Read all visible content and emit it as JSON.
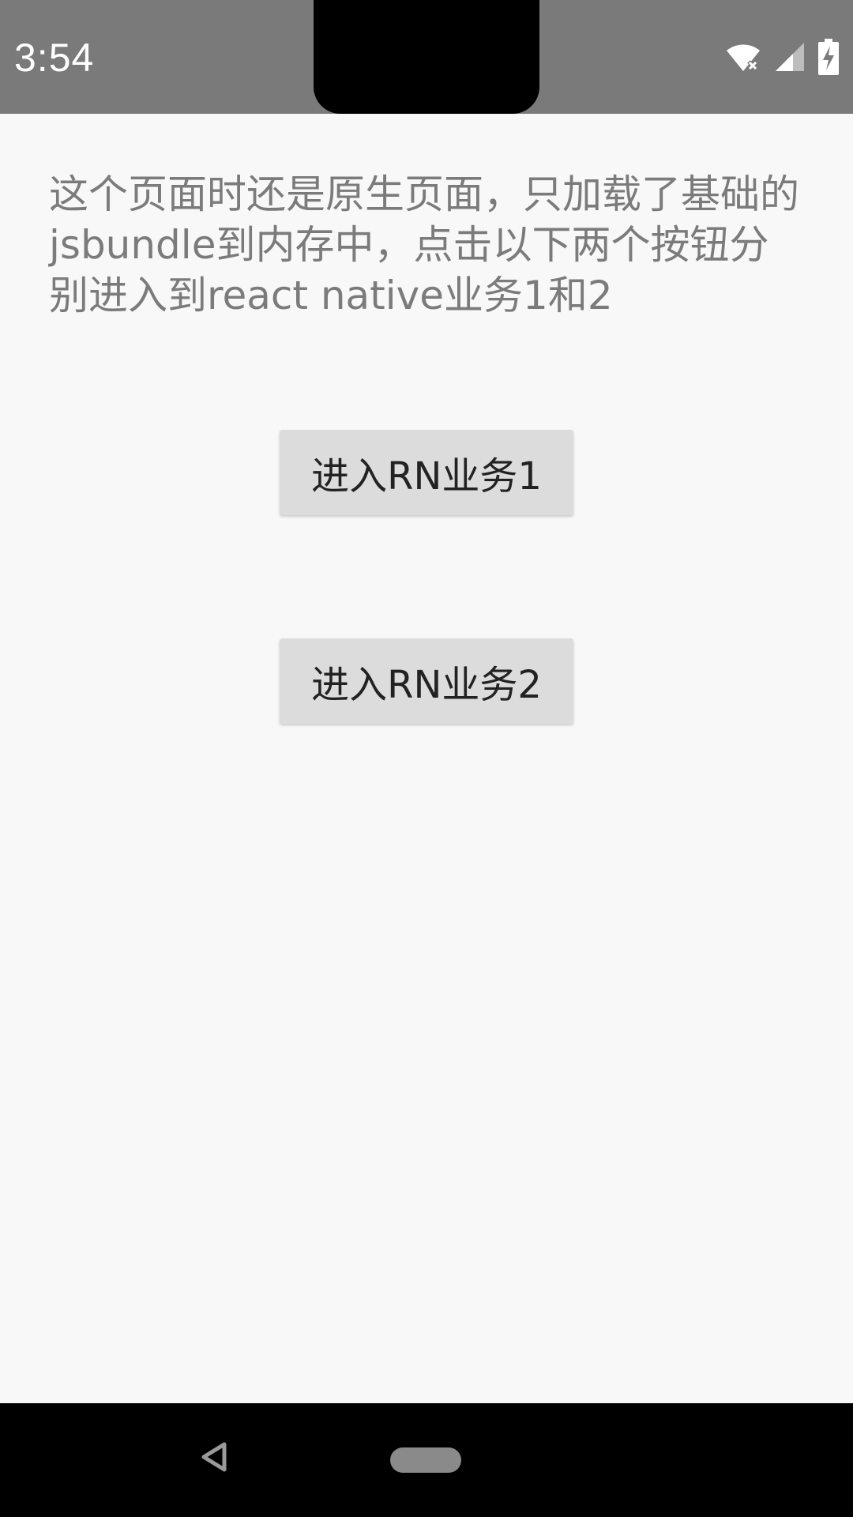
{
  "status_bar": {
    "time": "3:54",
    "icons": [
      "wifi-icon",
      "cell-signal-icon",
      "battery-charging-icon"
    ]
  },
  "main": {
    "intro_text": "这个页面时还是原生页面，只加载了基础的jsbundle到内存中，点击以下两个按钮分别进入到react native业务1和2",
    "buttons": [
      {
        "label": "进入RN业务1"
      },
      {
        "label": "进入RN业务2"
      }
    ]
  },
  "nav_bar": {
    "icons": [
      "back-icon",
      "home-pill-icon"
    ]
  },
  "colors": {
    "status_bar_bg": "#7a7a7a",
    "content_bg": "#f8f8f8",
    "button_bg": "#dcdcdc",
    "intro_text": "#7b7b7b",
    "nav_bar_bg": "#000000"
  }
}
